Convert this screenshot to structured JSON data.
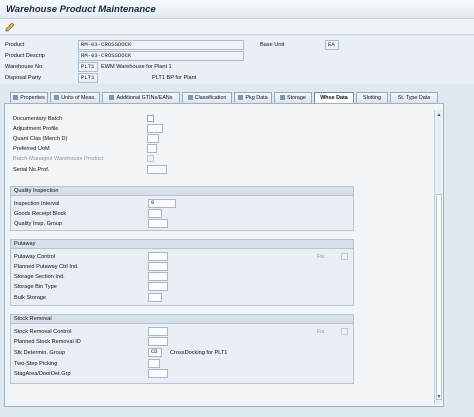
{
  "window": {
    "title": "Warehouse Product Maintenance"
  },
  "toolbar": {
    "icon": "display-change-icon"
  },
  "header": {
    "product_label": "Product",
    "product_value": "RM-03-CROSSDOCK",
    "base_unit_label": "Base Unit",
    "base_unit_value": "EA",
    "descr_label": "Product Descrip",
    "descr_value": "RM-03-CROSSDOCK",
    "whse_label": "Warehouse No.",
    "whse_value": "PLT1",
    "whse_text": "EWM Warehouse for Plant 1",
    "party_label": "Disposal Party",
    "party_value": "PLT1",
    "party_text": "PLT1 BP for Plant"
  },
  "tabs": [
    {
      "label": "Properties"
    },
    {
      "label": "Units of Meas."
    },
    {
      "label": "Additional GTINs/EANs"
    },
    {
      "label": "Classification"
    },
    {
      "label": "Pkg Data"
    },
    {
      "label": "Storage"
    },
    {
      "label": "Whse Data",
      "active": true
    },
    {
      "label": "Slotting"
    },
    {
      "label": "St. Type Data"
    }
  ],
  "general": {
    "doc_batch_label": "Documentary Batch",
    "adj_profile_label": "Adjustment Profile",
    "quant_clas_label": "Quant Clas (Merch D)",
    "pref_uom_label": "Preferred UoM",
    "batch_managed_label": "Batch-Managed Warehouse Product",
    "serial_label": "Serial No.Prof."
  },
  "quality": {
    "title": "Quality Inspection",
    "interval_label": "Inspection Interval",
    "interval_value": "0",
    "gr_block_label": "Goods Receipt Block",
    "insp_group_label": "Quality Insp. Group"
  },
  "putaway": {
    "title": "Putaway",
    "control_label": "Putaway Control",
    "fix_label": "Fix.",
    "planned_label": "Planned Putaway Ctrl Ind.",
    "section_label": "Storage Section Ind.",
    "bin_type_label": "Storage Bin Type",
    "bulk_label": "Bulk Storage"
  },
  "removal": {
    "title": "Stock Removal",
    "control_label": "Stock Removal Control",
    "fix_label": "Fix.",
    "planned_label": "Planned Stock Removal ID",
    "stk_group_label": "Stk Determin. Group",
    "stk_group_value": "CD",
    "stk_group_text": "CrossDocking for PLT1",
    "two_step_label": "Two-Step Picking",
    "stag_label": "StagArea/DoorDet.Grp"
  },
  "scroll": {
    "up": "▲",
    "down": "▼"
  }
}
